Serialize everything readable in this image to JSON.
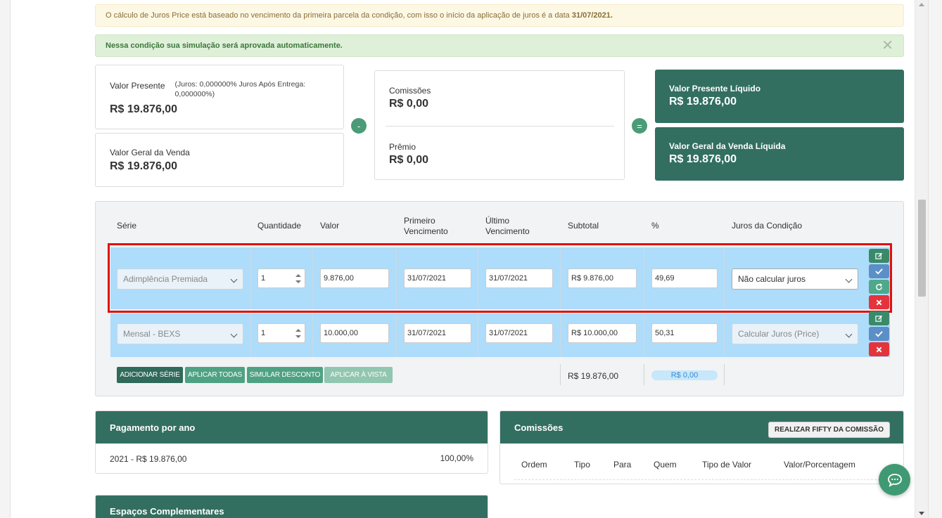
{
  "alerts": {
    "warning_text": "O cálculo de Juros Price está baseado no vencimento da primeira parcela da condição, com isso o início da aplicação de juros é a data ",
    "warning_date": "31/07/2021.",
    "success_text": "Nessa condição sua simulação será aprovada automaticamente.",
    "close_symbol": "✕"
  },
  "summary": {
    "valor_presente_label": "Valor Presente",
    "valor_presente_note": "(Juros: 0,000000%   Juros Após Entrega: 0,000000%)",
    "valor_presente_value": "R$ 19.876,00",
    "valor_geral_label": "Valor Geral da Venda",
    "valor_geral_value": "R$ 19.876,00",
    "minus_symbol": "-",
    "comissoes_label": "Comissões",
    "comissoes_value": "R$ 0,00",
    "premio_label": "Prêmio",
    "premio_value": "R$ 0,00",
    "equals_symbol": "=",
    "vp_liquido_label": "Valor Presente Líquido",
    "vp_liquido_value": "R$ 19.876,00",
    "vg_liquida_label": "Valor Geral da Venda Líquida",
    "vg_liquida_value": "R$ 19.876,00"
  },
  "series_table": {
    "headers": {
      "serie": "Série",
      "quantidade": "Quantidade",
      "valor": "Valor",
      "primeiro_1": "Primeiro",
      "primeiro_2": "Vencimento",
      "ultimo_1": "Último",
      "ultimo_2": "Vencimento",
      "subtotal": "Subtotal",
      "percent": "%",
      "juros": "Juros da Condição"
    },
    "rows": [
      {
        "serie": "Adimplência Premiada",
        "quantidade": "1",
        "valor": "9.876,00",
        "primeiro": "31/07/2021",
        "ultimo": "31/07/2021",
        "subtotal": "R$ 9.876,00",
        "percent": "49,69",
        "juros": "Não calcular juros"
      },
      {
        "serie": "Mensal - BEXS",
        "quantidade": "1",
        "valor": "10.000,00",
        "primeiro": "31/07/2021",
        "ultimo": "31/07/2021",
        "subtotal": "R$ 10.000,00",
        "percent": "50,31",
        "juros": "Calcular Juros (Price)"
      }
    ],
    "buttons": {
      "adicionar": "ADICIONAR SÉRIE",
      "aplicar_todas": "APLICAR TODAS",
      "simular_desconto": "SIMULAR DESCONTO",
      "aplicar_vista": "APLICAR À VISTA"
    },
    "total_subtotal": "R$ 19.876,00",
    "total_percent_pill": "R$ 0,00"
  },
  "pagamento": {
    "title": "Pagamento por ano",
    "row_label": "2021 - R$ 19.876,00",
    "row_percent": "100,00%"
  },
  "comissoes": {
    "title": "Comissões",
    "button": "REALIZAR FIFTY DA COMISSÃO",
    "columns": [
      "Ordem",
      "Tipo",
      "Para",
      "Quem",
      "Tipo de Valor",
      "Valor/Porcentagem"
    ]
  },
  "espacos": {
    "title": "Espaços Complementares"
  },
  "colors": {
    "brand_dark": "#326f60",
    "row_highlight": "#aedcfb",
    "selection_border": "#e01010"
  },
  "icons": [
    "edit-icon",
    "check-icon",
    "refresh-icon",
    "delete-icon",
    "chat-icon",
    "close-icon",
    "chevron-down-icon"
  ]
}
